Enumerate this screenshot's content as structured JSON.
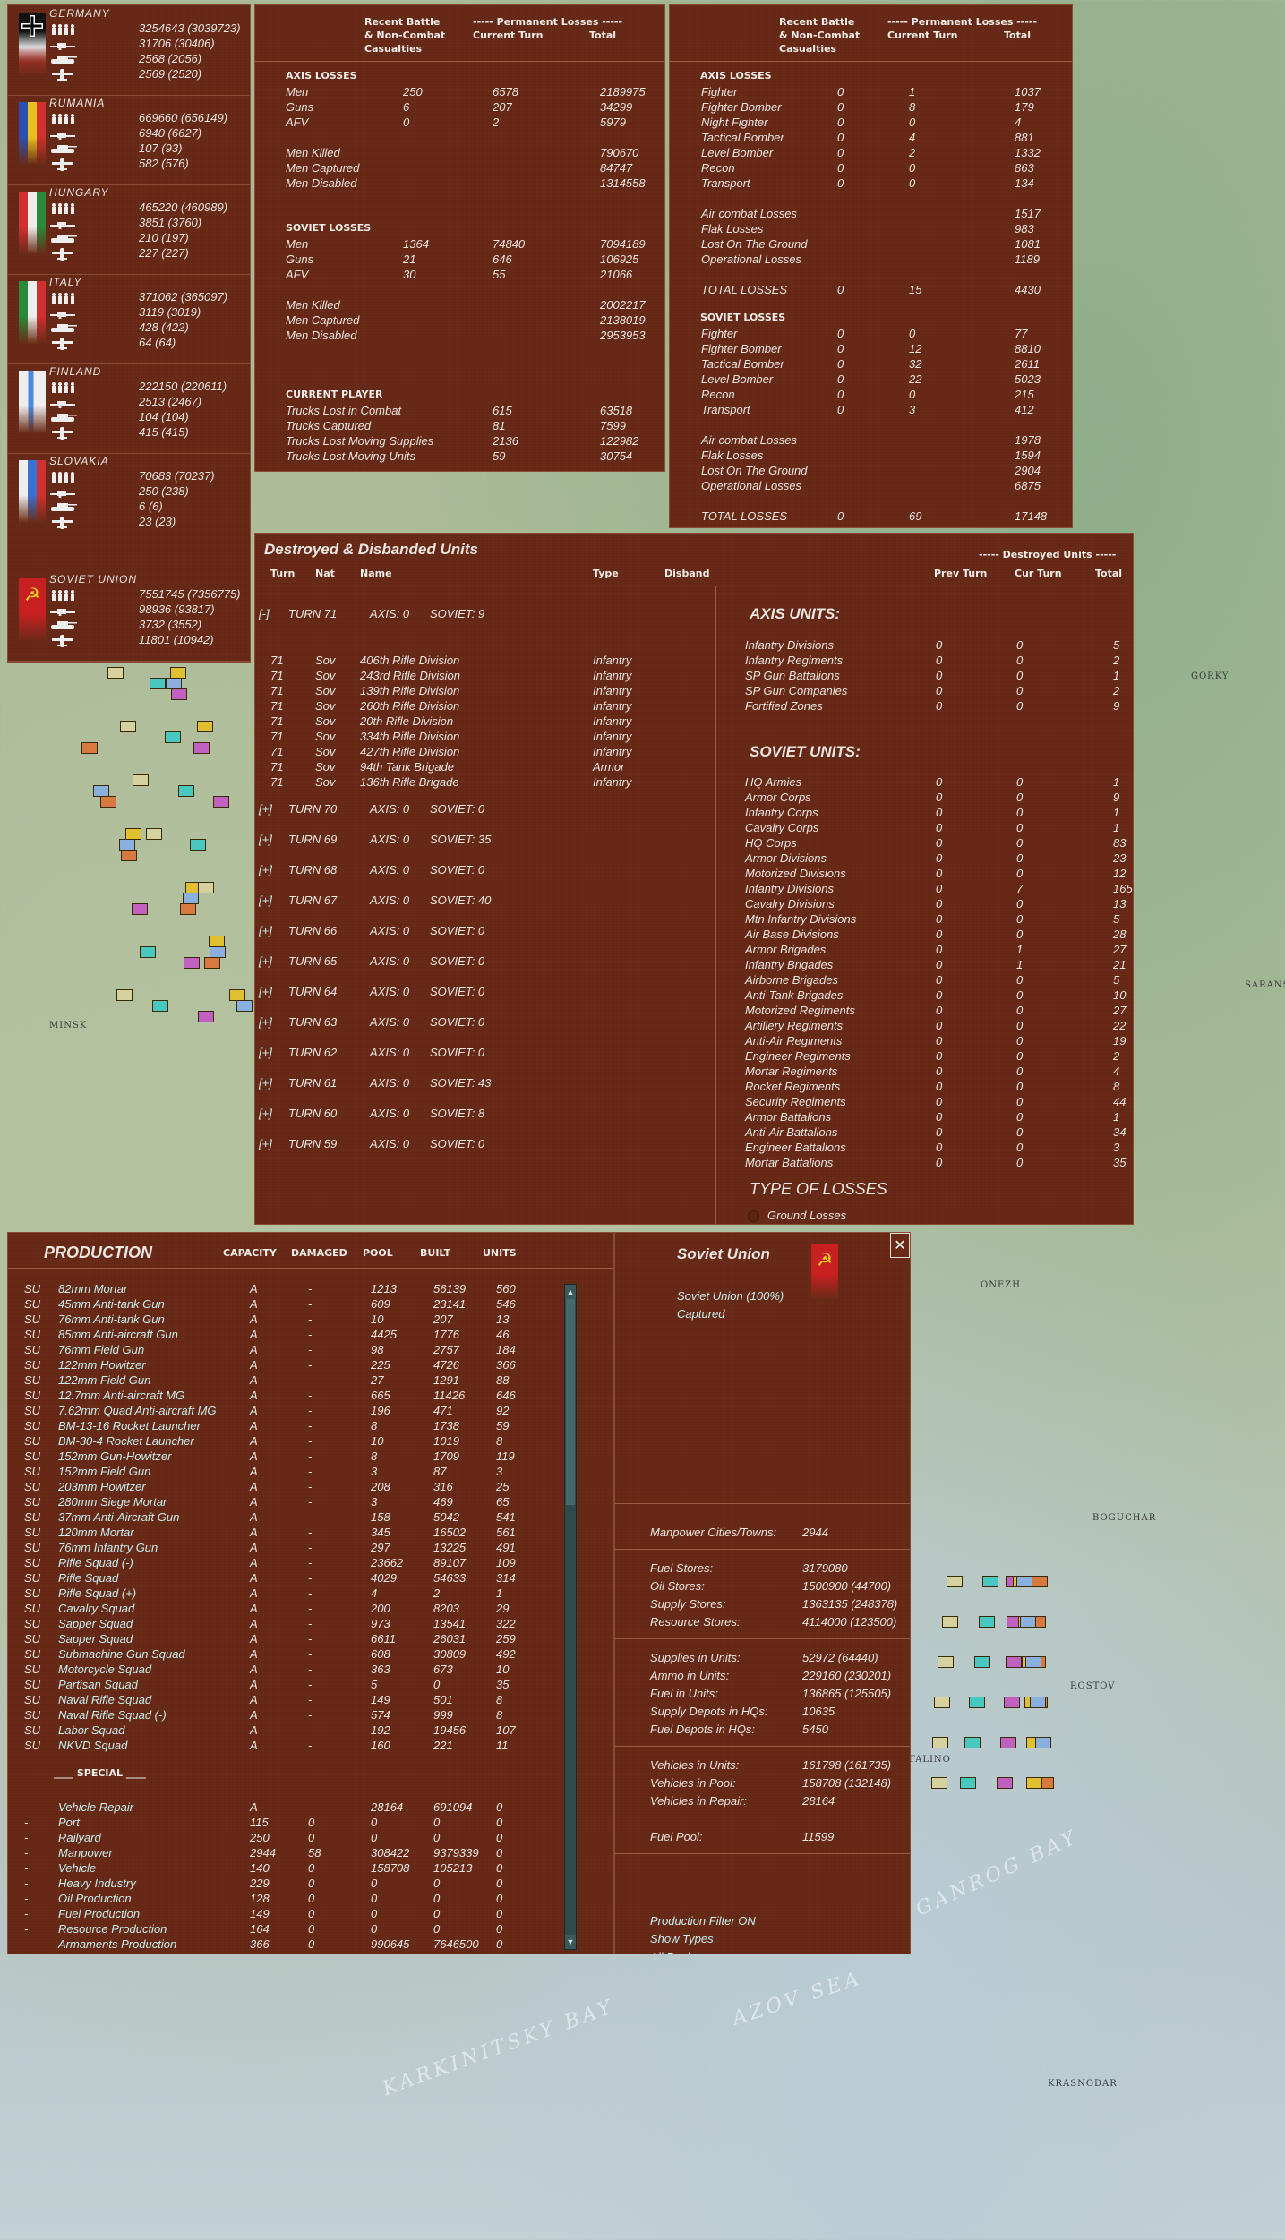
{
  "map": {
    "labels": [
      "MINSK",
      "GORKY",
      "ROSTOV",
      "KRASNODAR",
      "ONEZH",
      "BOGUCHAR",
      "TALINO",
      "SARANSK"
    ],
    "seas": [
      "AZOV SEA",
      "KARKINITSKY BAY",
      "GANROG BAY"
    ]
  },
  "nations": [
    {
      "name": "GERMANY",
      "flag": "germany",
      "men": "3254643 (3039723)",
      "guns": "31706 (30406)",
      "afv": "2568 (2056)",
      "air": "2569 (2520)"
    },
    {
      "name": "RUMANIA",
      "flag": "rumania",
      "men": "669660 (656149)",
      "guns": "6940 (6627)",
      "afv": "107 (93)",
      "air": "582 (576)"
    },
    {
      "name": "HUNGARY",
      "flag": "hungary",
      "men": "465220 (460989)",
      "guns": "3851 (3760)",
      "afv": "210 (197)",
      "air": "227 (227)"
    },
    {
      "name": "ITALY",
      "flag": "italy",
      "men": "371062 (365097)",
      "guns": "3119 (3019)",
      "afv": "428 (422)",
      "air": "64 (64)"
    },
    {
      "name": "FINLAND",
      "flag": "finland",
      "men": "222150 (220611)",
      "guns": "2513 (2467)",
      "afv": "104 (104)",
      "air": "415 (415)"
    },
    {
      "name": "SLOVAKIA",
      "flag": "slovakia",
      "men": "70683 (70237)",
      "guns": "250 (238)",
      "afv": "6 (6)",
      "air": "23 (23)"
    },
    {
      "name": "SOVIET UNION",
      "flag": "soviet",
      "men": "7551745 (7356775)",
      "guns": "98936 (93817)",
      "afv": "3732 (3552)",
      "air": "11801 (10942)"
    }
  ],
  "headers": {
    "recent": [
      "Recent Battle",
      "& Non-Combat",
      "Casualties"
    ],
    "perm": "----- Permanent Losses -----",
    "current": "Current Turn",
    "total": "Total"
  },
  "ground": {
    "axis_title": "AXIS LOSSES",
    "axis_rows": [
      [
        "Men",
        "250",
        "6578",
        "2189975"
      ],
      [
        "Guns",
        "6",
        "207",
        "34299"
      ],
      [
        "AFV",
        "0",
        "2",
        "5979"
      ]
    ],
    "axis_sub": [
      [
        "Men Killed",
        "790670"
      ],
      [
        "Men Captured",
        "84747"
      ],
      [
        "Men Disabled",
        "1314558"
      ]
    ],
    "soviet_title": "SOVIET LOSSES",
    "soviet_rows": [
      [
        "Men",
        "1364",
        "74840",
        "7094189"
      ],
      [
        "Guns",
        "21",
        "646",
        "106925"
      ],
      [
        "AFV",
        "30",
        "55",
        "21066"
      ]
    ],
    "soviet_sub": [
      [
        "Men Killed",
        "2002217"
      ],
      [
        "Men Captured",
        "2138019"
      ],
      [
        "Men Disabled",
        "2953953"
      ]
    ],
    "player_title": "CURRENT PLAYER",
    "player_rows": [
      [
        "Trucks Lost in Combat",
        "615",
        "63518"
      ],
      [
        "Trucks Captured",
        "81",
        "7599"
      ],
      [
        "Trucks Lost Moving Supplies",
        "2136",
        "122982"
      ],
      [
        "Trucks Lost Moving Units",
        "59",
        "30754"
      ]
    ]
  },
  "air": {
    "axis_title": "AXIS LOSSES",
    "axis_rows": [
      [
        "Fighter",
        "0",
        "1",
        "1037"
      ],
      [
        "Fighter Bomber",
        "0",
        "8",
        "179"
      ],
      [
        "Night Fighter",
        "0",
        "0",
        "4"
      ],
      [
        "Tactical Bomber",
        "0",
        "4",
        "881"
      ],
      [
        "Level Bomber",
        "0",
        "2",
        "1332"
      ],
      [
        "Recon",
        "0",
        "0",
        "863"
      ],
      [
        "Transport",
        "0",
        "0",
        "134"
      ]
    ],
    "axis_sub": [
      [
        "Air combat Losses",
        "1517"
      ],
      [
        "Flak Losses",
        "983"
      ],
      [
        "Lost On The Ground",
        "1081"
      ],
      [
        "Operational Losses",
        "1189"
      ]
    ],
    "axis_total": [
      "TOTAL LOSSES",
      "0",
      "15",
      "4430"
    ],
    "soviet_title": "SOVIET LOSSES",
    "soviet_rows": [
      [
        "Fighter",
        "0",
        "0",
        "77"
      ],
      [
        "Fighter Bomber",
        "0",
        "12",
        "8810"
      ],
      [
        "Tactical Bomber",
        "0",
        "32",
        "2611"
      ],
      [
        "Level Bomber",
        "0",
        "22",
        "5023"
      ],
      [
        "Recon",
        "0",
        "0",
        "215"
      ],
      [
        "Transport",
        "0",
        "3",
        "412"
      ]
    ],
    "soviet_sub": [
      [
        "Air combat Losses",
        "1978"
      ],
      [
        "Flak Losses",
        "1594"
      ],
      [
        "Lost On The Ground",
        "2904"
      ],
      [
        "Operational Losses",
        "6875"
      ]
    ],
    "soviet_total": [
      "TOTAL LOSSES",
      "0",
      "69",
      "17148"
    ]
  },
  "destroyed": {
    "title": "Destroyed & Disbanded Units",
    "cols": [
      "Turn",
      "Nat",
      "Name",
      "Type",
      "Disband"
    ],
    "right_header": "----- Destroyed Units -----",
    "right_cols": [
      "Prev Turn",
      "Cur Turn",
      "Total"
    ],
    "expanded": {
      "toggle": "[-]",
      "turn": "TURN 71",
      "axis": "AXIS: 0",
      "soviet": "SOVIET: 9"
    },
    "units": [
      [
        "71",
        "Sov",
        "406th Rifle Division",
        "Infantry"
      ],
      [
        "71",
        "Sov",
        "243rd Rifle Division",
        "Infantry"
      ],
      [
        "71",
        "Sov",
        "139th Rifle Division",
        "Infantry"
      ],
      [
        "71",
        "Sov",
        "260th Rifle Division",
        "Infantry"
      ],
      [
        "71",
        "Sov",
        "20th Rifle Division",
        "Infantry"
      ],
      [
        "71",
        "Sov",
        "334th Rifle Division",
        "Infantry"
      ],
      [
        "71",
        "Sov",
        "427th Rifle Division",
        "Infantry"
      ],
      [
        "71",
        "Sov",
        "94th Tank Brigade",
        "Armor"
      ],
      [
        "71",
        "Sov",
        "136th Rifle Brigade",
        "Infantry"
      ]
    ],
    "turns": [
      [
        "[+]",
        "TURN 70",
        "AXIS: 0",
        "SOVIET: 0"
      ],
      [
        "[+]",
        "TURN 69",
        "AXIS: 0",
        "SOVIET: 35"
      ],
      [
        "[+]",
        "TURN 68",
        "AXIS: 0",
        "SOVIET: 0"
      ],
      [
        "[+]",
        "TURN 67",
        "AXIS: 0",
        "SOVIET: 40"
      ],
      [
        "[+]",
        "TURN 66",
        "AXIS: 0",
        "SOVIET: 0"
      ],
      [
        "[+]",
        "TURN 65",
        "AXIS: 0",
        "SOVIET: 0"
      ],
      [
        "[+]",
        "TURN 64",
        "AXIS: 0",
        "SOVIET: 0"
      ],
      [
        "[+]",
        "TURN 63",
        "AXIS: 0",
        "SOVIET: 0"
      ],
      [
        "[+]",
        "TURN 62",
        "AXIS: 0",
        "SOVIET: 0"
      ],
      [
        "[+]",
        "TURN 61",
        "AXIS: 0",
        "SOVIET: 43"
      ],
      [
        "[+]",
        "TURN 60",
        "AXIS: 0",
        "SOVIET: 8"
      ],
      [
        "[+]",
        "TURN 59",
        "AXIS: 0",
        "SOVIET: 0"
      ]
    ],
    "axis_title": "AXIS UNITS:",
    "axis_units": [
      [
        "Infantry Divisions",
        "0",
        "0",
        "5"
      ],
      [
        "Infantry Regiments",
        "0",
        "0",
        "2"
      ],
      [
        "SP Gun Battalions",
        "0",
        "0",
        "1"
      ],
      [
        "SP Gun Companies",
        "0",
        "0",
        "2"
      ],
      [
        "Fortified Zones",
        "0",
        "0",
        "9"
      ]
    ],
    "soviet_title": "SOVIET UNITS:",
    "soviet_units": [
      [
        "HQ Armies",
        "0",
        "0",
        "1"
      ],
      [
        "Armor Corps",
        "0",
        "0",
        "9"
      ],
      [
        "Infantry Corps",
        "0",
        "0",
        "1"
      ],
      [
        "Cavalry Corps",
        "0",
        "0",
        "1"
      ],
      [
        "HQ Corps",
        "0",
        "0",
        "83"
      ],
      [
        "Armor Divisions",
        "0",
        "0",
        "23"
      ],
      [
        "Motorized Divisions",
        "0",
        "0",
        "12"
      ],
      [
        "Infantry Divisions",
        "0",
        "7",
        "165"
      ],
      [
        "Cavalry Divisions",
        "0",
        "0",
        "13"
      ],
      [
        "Mtn Infantry Divisions",
        "0",
        "0",
        "5"
      ],
      [
        "Air Base Divisions",
        "0",
        "0",
        "28"
      ],
      [
        "Armor Brigades",
        "0",
        "1",
        "27"
      ],
      [
        "Infantry Brigades",
        "0",
        "1",
        "21"
      ],
      [
        "Airborne Brigades",
        "0",
        "0",
        "5"
      ],
      [
        "Anti-Tank Brigades",
        "0",
        "0",
        "10"
      ],
      [
        "Motorized Regiments",
        "0",
        "0",
        "27"
      ],
      [
        "Artillery Regiments",
        "0",
        "0",
        "22"
      ],
      [
        "Anti-Air Regiments",
        "0",
        "0",
        "19"
      ],
      [
        "Engineer Regiments",
        "0",
        "0",
        "2"
      ],
      [
        "Mortar Regiments",
        "0",
        "0",
        "4"
      ],
      [
        "Rocket Regiments",
        "0",
        "0",
        "8"
      ],
      [
        "Security Regiments",
        "0",
        "0",
        "44"
      ],
      [
        "Armor Battalions",
        "0",
        "0",
        "1"
      ],
      [
        "Anti-Air Battalions",
        "0",
        "0",
        "34"
      ],
      [
        "Engineer Battalions",
        "0",
        "0",
        "3"
      ],
      [
        "Mortar Battalions",
        "0",
        "0",
        "35"
      ]
    ],
    "loss_type_title": "TYPE OF LOSSES",
    "loss_type_option": "Ground Losses"
  },
  "production": {
    "title": "PRODUCTION",
    "cols": [
      "CAPACITY",
      "DAMAGED",
      "POOL",
      "BUILT",
      "UNITS"
    ],
    "rows": [
      [
        "SU",
        "82mm Mortar",
        "A",
        "-",
        "1213",
        "56139",
        "560"
      ],
      [
        "SU",
        "45mm Anti-tank Gun",
        "A",
        "-",
        "609",
        "23141",
        "546"
      ],
      [
        "SU",
        "76mm Anti-tank Gun",
        "A",
        "-",
        "10",
        "207",
        "13"
      ],
      [
        "SU",
        "85mm Anti-aircraft Gun",
        "A",
        "-",
        "4425",
        "1776",
        "46"
      ],
      [
        "SU",
        "76mm Field Gun",
        "A",
        "-",
        "98",
        "2757",
        "184"
      ],
      [
        "SU",
        "122mm Howitzer",
        "A",
        "-",
        "225",
        "4726",
        "366"
      ],
      [
        "SU",
        "122mm Field Gun",
        "A",
        "-",
        "27",
        "1291",
        "88"
      ],
      [
        "SU",
        "12.7mm Anti-aircraft MG",
        "A",
        "-",
        "665",
        "11426",
        "646"
      ],
      [
        "SU",
        "7.62mm Quad Anti-aircraft MG",
        "A",
        "-",
        "196",
        "471",
        "92"
      ],
      [
        "SU",
        "BM-13-16 Rocket Launcher",
        "A",
        "-",
        "8",
        "1738",
        "59"
      ],
      [
        "SU",
        "BM-30-4 Rocket Launcher",
        "A",
        "-",
        "10",
        "1019",
        "8"
      ],
      [
        "SU",
        "152mm Gun-Howitzer",
        "A",
        "-",
        "8",
        "1709",
        "119"
      ],
      [
        "SU",
        "152mm Field Gun",
        "A",
        "-",
        "3",
        "87",
        "3"
      ],
      [
        "SU",
        "203mm Howitzer",
        "A",
        "-",
        "208",
        "316",
        "25"
      ],
      [
        "SU",
        "280mm Siege Mortar",
        "A",
        "-",
        "3",
        "469",
        "65"
      ],
      [
        "SU",
        "37mm Anti-Aircraft Gun",
        "A",
        "-",
        "158",
        "5042",
        "541"
      ],
      [
        "SU",
        "120mm Mortar",
        "A",
        "-",
        "345",
        "16502",
        "561"
      ],
      [
        "SU",
        "76mm Infantry Gun",
        "A",
        "-",
        "297",
        "13225",
        "491"
      ],
      [
        "SU",
        "Rifle Squad (-)",
        "A",
        "-",
        "23662",
        "89107",
        "109"
      ],
      [
        "SU",
        "Rifle Squad",
        "A",
        "-",
        "4029",
        "54633",
        "314"
      ],
      [
        "SU",
        "Rifle Squad (+)",
        "A",
        "-",
        "4",
        "2",
        "1"
      ],
      [
        "SU",
        "Cavalry Squad",
        "A",
        "-",
        "200",
        "8203",
        "29"
      ],
      [
        "SU",
        "Sapper Squad",
        "A",
        "-",
        "973",
        "13541",
        "322"
      ],
      [
        "SU",
        "Sapper Squad",
        "A",
        "-",
        "6611",
        "26031",
        "259"
      ],
      [
        "SU",
        "Submachine Gun Squad",
        "A",
        "-",
        "608",
        "30809",
        "492"
      ],
      [
        "SU",
        "Motorcycle Squad",
        "A",
        "-",
        "363",
        "673",
        "10"
      ],
      [
        "SU",
        "Partisan Squad",
        "A",
        "-",
        "5",
        "0",
        "35"
      ],
      [
        "SU",
        "Naval Rifle Squad",
        "A",
        "-",
        "149",
        "501",
        "8"
      ],
      [
        "SU",
        "Naval Rifle Squad (-)",
        "A",
        "-",
        "574",
        "999",
        "8"
      ],
      [
        "SU",
        "Labor Squad",
        "A",
        "-",
        "192",
        "19456",
        "107"
      ],
      [
        "SU",
        "NKVD Squad",
        "A",
        "-",
        "160",
        "221",
        "11"
      ]
    ],
    "special_title": "____ SPECIAL ____",
    "special_rows": [
      [
        "-",
        "Vehicle Repair",
        "A",
        "-",
        "28164",
        "691094",
        "0"
      ],
      [
        "-",
        "Port",
        "115",
        "0",
        "0",
        "0",
        "0"
      ],
      [
        "-",
        "Railyard",
        "250",
        "0",
        "0",
        "0",
        "0"
      ],
      [
        "-",
        "Manpower",
        "2944",
        "58",
        "308422",
        "9379339",
        "0"
      ],
      [
        "-",
        "Vehicle",
        "140",
        "0",
        "158708",
        "105213",
        "0"
      ],
      [
        "-",
        "Heavy Industry",
        "229",
        "0",
        "0",
        "0",
        "0"
      ],
      [
        "-",
        "Oil Production",
        "128",
        "0",
        "0",
        "0",
        "0"
      ],
      [
        "-",
        "Fuel Production",
        "149",
        "0",
        "0",
        "0",
        "0"
      ],
      [
        "-",
        "Resource Production",
        "164",
        "0",
        "0",
        "0",
        "0"
      ],
      [
        "-",
        "Armaments Production",
        "366",
        "0",
        "990645",
        "7646500",
        "0"
      ]
    ]
  },
  "info": {
    "title": "Soviet Union",
    "share": "Soviet Union  (100%)",
    "captured": "Captured",
    "close": "✕",
    "groups": [
      [
        [
          "Manpower Cities/Towns:",
          "2944"
        ]
      ],
      [
        [
          "Fuel Stores:",
          "3179080"
        ],
        [
          "Oil Stores:",
          "1500900 (44700)"
        ],
        [
          "Supply Stores:",
          "1363135 (248378)"
        ],
        [
          "Resource Stores:",
          "4114000 (123500)"
        ]
      ],
      [
        [
          "Supplies in Units:",
          "52972 (64440)"
        ],
        [
          "Ammo in Units:",
          "229160 (230201)"
        ],
        [
          "Fuel in Units:",
          "136865 (125505)"
        ],
        [
          "Supply Depots in HQs:",
          "10635"
        ],
        [
          "Fuel Depots in HQs:",
          "5450"
        ]
      ],
      [
        [
          "Vehicles in Units:",
          "161798 (161735)"
        ],
        [
          "Vehicles in Pool:",
          "158708 (132148)"
        ],
        [
          "Vehicles in Repair:",
          "28164"
        ],
        [
          "",
          ""
        ],
        [
          "Fuel Pool:",
          "11599"
        ]
      ]
    ],
    "links": [
      "Production Filter ON",
      "Show Types",
      "All Pools"
    ]
  }
}
